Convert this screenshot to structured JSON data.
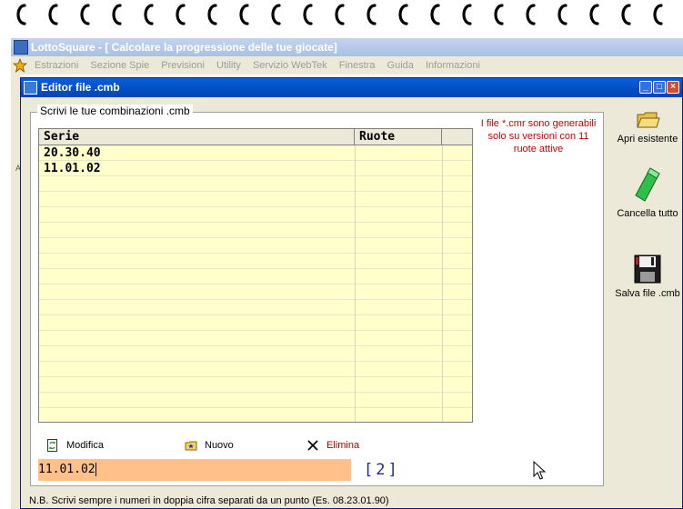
{
  "app": {
    "title": "LottoSquare - [ Calcolare la progressione delle tue giocate]",
    "menu": [
      "Estrazioni",
      "Sezione Spie",
      "Previsioni",
      "Utility",
      "Servizio WebTek",
      "Finestra",
      "Guida",
      "Informazioni"
    ],
    "left_letter": "A"
  },
  "editor": {
    "title": "Editor file .cmb",
    "group_label": "Scrivi le tue combinazioni .cmb",
    "note": "I file *.cmr sono generabili solo su versioni con 11 ruote attive",
    "columns": [
      "Serie",
      "Ruote",
      ""
    ],
    "rows": [
      {
        "serie": "20.30.40",
        "ruote": ""
      },
      {
        "serie": "11.01.02",
        "ruote": ""
      }
    ],
    "actions": {
      "modify": "Modifica",
      "new": "Nuovo",
      "delete": "Elimina"
    },
    "input_value": "11.01.02",
    "count": "[2]",
    "side": {
      "open": "Apri esistente",
      "clear": "Cancella tutto",
      "save": "Salva file .cmb"
    },
    "footnote": "N.B. Scrivi sempre i numeri in doppia cifra separati da un punto (Es. 08.23.01.90)"
  }
}
